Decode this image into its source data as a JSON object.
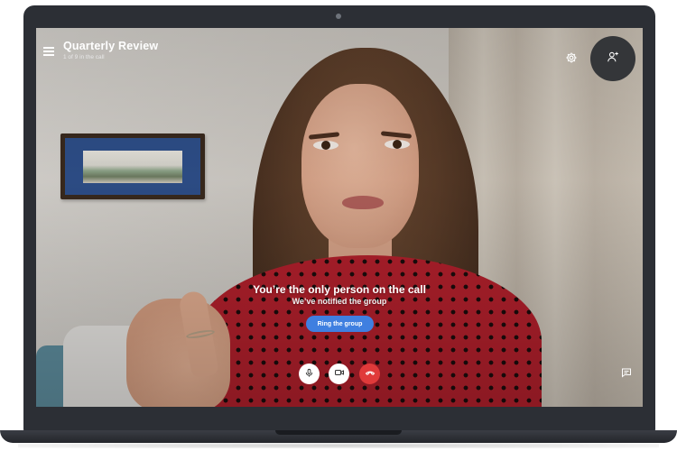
{
  "call": {
    "title": "Quarterly Review",
    "subtitle": "1 of 9 in the call",
    "status_title": "You’re the only person on the call",
    "status_subtitle": "We’ve notified the group",
    "ring_label": "Ring the group"
  },
  "icons": {
    "menu": "hamburger-icon",
    "settings": "gear-icon",
    "add_people": "add-person-icon",
    "mic": "microphone-icon",
    "camera": "video-camera-icon",
    "hang_up": "phone-hangup-icon",
    "chat": "chat-bubble-icon"
  },
  "colors": {
    "ring_button": "#3f7fe0",
    "hang_up": "#e03a3a",
    "add_people_bg": "#343639",
    "bezel": "#2c2f35"
  }
}
